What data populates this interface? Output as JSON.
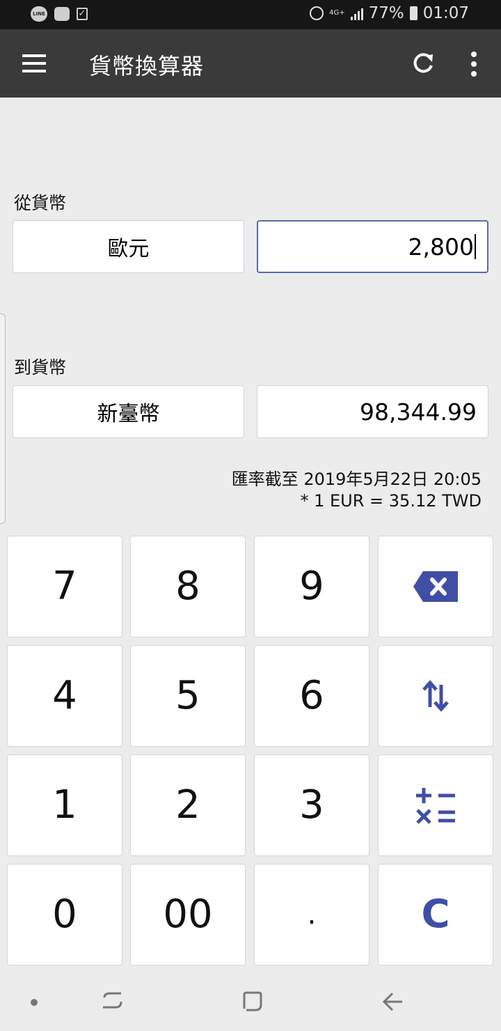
{
  "status_bar": {
    "left_icons": [
      "line-icon",
      "keyboard-icon",
      "checklist-icon"
    ],
    "line_label": "LINE",
    "network": "4G+",
    "battery": "77%",
    "time": "01:07"
  },
  "app_bar": {
    "title": "貨幣換算器",
    "actions": [
      "refresh-icon",
      "more-vert-icon"
    ]
  },
  "converter": {
    "from_label": "從貨幣",
    "from_currency": "歐元",
    "from_amount": "2,800",
    "to_label": "到貨幣",
    "to_currency": "新臺幣",
    "to_amount": "98,344.99",
    "rate_timestamp": "匯率截至 2019年5月22日 20:05",
    "rate_formula": "* 1 EUR = 35.12 TWD"
  },
  "keypad": {
    "k7": "7",
    "k8": "8",
    "k9": "9",
    "k4": "4",
    "k5": "5",
    "k6": "6",
    "k1": "1",
    "k2": "2",
    "k3": "3",
    "k0": "0",
    "k00": "00",
    "kdot": ".",
    "kclear": "C",
    "special_icons": [
      "backspace-icon",
      "swap-icon",
      "calculator-icon"
    ]
  },
  "colors": {
    "accent": "#3f4fa6",
    "app_bar": "#3a3a3a",
    "status_bar": "#161616",
    "background": "#ececec"
  }
}
